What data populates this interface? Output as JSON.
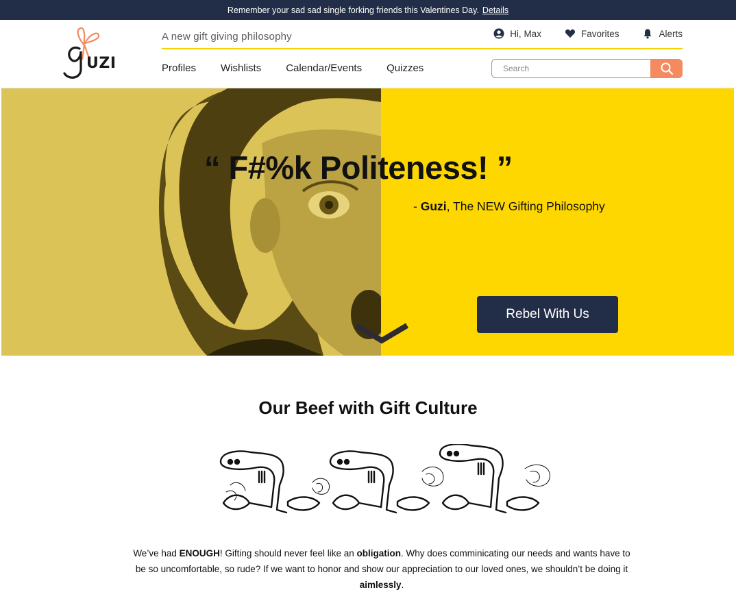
{
  "announcement": {
    "text": "Remember your sad sad single forking friends this Valentines Day.",
    "link": "Details"
  },
  "header": {
    "logo_text": "Guzi",
    "tagline": "A new gift giving philosophy",
    "user_links": {
      "greeting": "Hi, Max",
      "favorites": "Favorites",
      "alerts": "Alerts"
    },
    "nav": [
      "Profiles",
      "Wishlists",
      "Calendar/Events",
      "Quizzes"
    ],
    "search": {
      "placeholder": "Search"
    }
  },
  "hero": {
    "quote": "“ F#%k Politeness! ”",
    "attribution_prefix": "- ",
    "attribution_brand": "Guzi",
    "attribution_suffix": ", The NEW Gifting Philosophy",
    "cta": "Rebel With Us"
  },
  "beef": {
    "title": "Our Beef with Gift Culture",
    "p1_a": "We’ve had ",
    "p1_b": "ENOUGH",
    "p1_c": "!  Gifting should never feel like an ",
    "p1_d": "obligation",
    "p1_e": ". Why does comminicating our needs and wants have to be so uncomfortable, so rude? If we want to honor and show our appreciation  to our loved ones, we shouldn’t be doing it ",
    "p1_f": "aimlessly",
    "p1_g": "."
  },
  "colors": {
    "navy": "#222d47",
    "yellow": "#fed700",
    "coral": "#f58a60"
  },
  "icons": [
    "user-circle-icon",
    "heart-icon",
    "bell-icon",
    "search-icon",
    "chevron-down-icon"
  ]
}
